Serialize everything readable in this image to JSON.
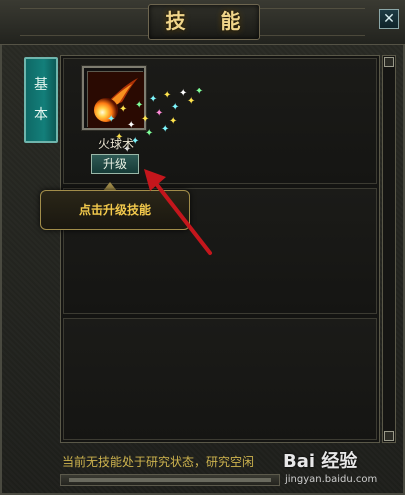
{
  "window": {
    "title": "技 能",
    "close_label": "✕"
  },
  "tabs": [
    {
      "label_top": "基",
      "label_bottom": "本"
    }
  ],
  "skill": {
    "name": "火球术",
    "upgrade_label": "升级",
    "icon": "fireball-icon"
  },
  "tooltip": {
    "text": "点击升级技能"
  },
  "status": {
    "text": "当前无技能处于研究状态，研究空闲"
  },
  "watermark": {
    "logo": "Bai 经验",
    "url": "jingyan.baidu.com"
  },
  "colors": {
    "title_gold": "#f0d58a",
    "tab_teal": "#137f7a",
    "tooltip_text": "#f2c94c",
    "status_text": "#cdb34e",
    "arrow_red": "#c4161c"
  }
}
